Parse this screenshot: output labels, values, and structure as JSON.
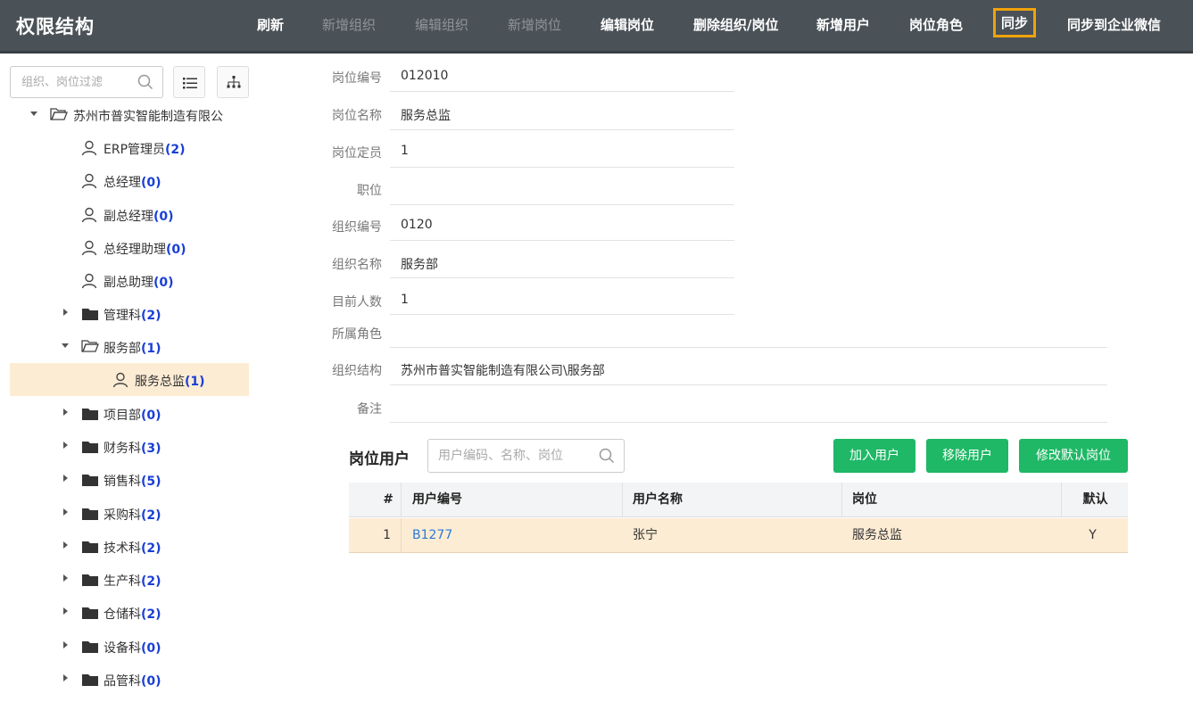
{
  "app": {
    "title": "权限结构"
  },
  "toolbar": {
    "refresh": "刷新",
    "add_org": "新增组织",
    "edit_org": "编辑组织",
    "add_post": "新增岗位",
    "edit_post": "编辑岗位",
    "delete_org_post": "删除组织/岗位",
    "add_user": "新增用户",
    "post_role": "岗位角色",
    "sync": "同步",
    "sync_wecom": "同步到企业微信"
  },
  "sidebar": {
    "filter_placeholder": "组织、岗位过滤",
    "root": {
      "label": "苏州市普实智能制造有限公"
    },
    "root_posts": [
      {
        "label": "ERP管理员",
        "count": "(2)"
      },
      {
        "label": "总经理",
        "count": "(0)"
      },
      {
        "label": "副总经理",
        "count": "(0)"
      },
      {
        "label": "总经理助理",
        "count": "(0)"
      },
      {
        "label": "副总助理",
        "count": "(0)"
      }
    ],
    "dept_mgmt": {
      "label": "管理科",
      "count": "(2)"
    },
    "dept_service": {
      "label": "服务部",
      "count": "(1)"
    },
    "selected_post": {
      "label": "服务总监",
      "count": "(1)"
    },
    "depts": [
      {
        "label": "项目部",
        "count": "(0)"
      },
      {
        "label": "财务科",
        "count": "(3)"
      },
      {
        "label": "销售科",
        "count": "(5)"
      },
      {
        "label": "采购科",
        "count": "(2)"
      },
      {
        "label": "技术科",
        "count": "(2)"
      },
      {
        "label": "生产科",
        "count": "(2)"
      },
      {
        "label": "仓储科",
        "count": "(2)"
      },
      {
        "label": "设备科",
        "count": "(0)"
      },
      {
        "label": "品管科",
        "count": "(0)"
      }
    ]
  },
  "detail": {
    "post_code": {
      "label": "岗位编号",
      "value": "012010"
    },
    "post_name": {
      "label": "岗位名称",
      "value": "服务总监"
    },
    "headcount": {
      "label": "岗位定员",
      "value": "1"
    },
    "rank": {
      "label": "职位",
      "value": ""
    },
    "org_code": {
      "label": "组织编号",
      "value": "0120"
    },
    "org_name": {
      "label": "组织名称",
      "value": "服务部"
    },
    "current_count": {
      "label": "目前人数",
      "value": "1"
    },
    "roles": {
      "label": "所属角色",
      "value": ""
    },
    "org_path": {
      "label": "组织结构",
      "value": "苏州市普实智能制造有限公司\\服务部"
    },
    "remark": {
      "label": "备注",
      "value": ""
    }
  },
  "post_users": {
    "title": "岗位用户",
    "search_placeholder": "用户编码、名称、岗位",
    "add_btn": "加入用户",
    "remove_btn": "移除用户",
    "change_default_btn": "修改默认岗位",
    "columns": {
      "index": "#",
      "code": "用户编号",
      "name": "用户名称",
      "post": "岗位",
      "default": "默认"
    },
    "rows": [
      {
        "index": "1",
        "code": "B1277",
        "name": "张宁",
        "post": "服务总监",
        "default": "Y"
      }
    ]
  },
  "colors": {
    "accent_green": "#1fb866",
    "topbar": "#4a5157",
    "highlight": "#f0a30a",
    "count_blue": "#1a3fd6"
  }
}
